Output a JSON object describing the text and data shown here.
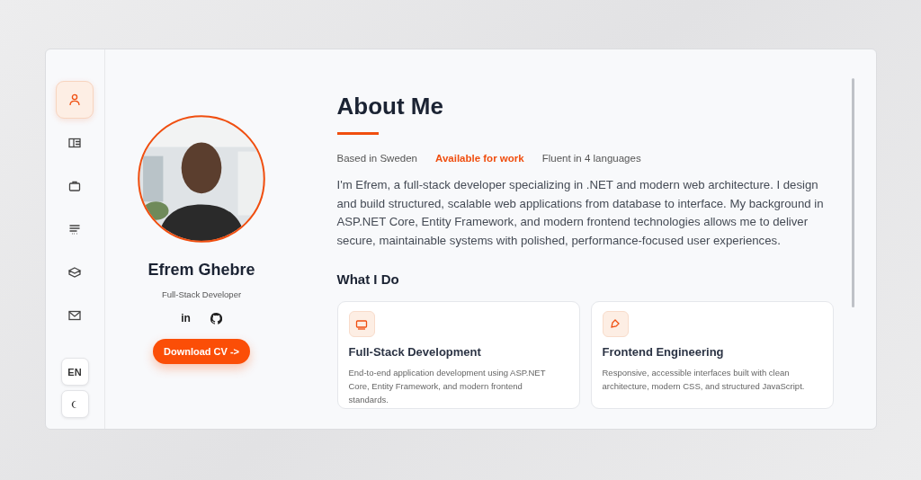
{
  "nav": [
    {
      "selected": true
    },
    {
      "selected": false
    },
    {
      "selected": false
    },
    {
      "selected": false
    },
    {
      "selected": false
    },
    {
      "selected": false
    }
  ],
  "language_button": "EN",
  "profile": {
    "name": "Efrem Ghebre",
    "role": "Full-Stack Developer",
    "social": [
      {
        "kind": "linkedin",
        "label": "in"
      },
      {
        "kind": "github"
      }
    ],
    "download_button": "Download CV ->"
  },
  "about": {
    "title": "About Me",
    "facts": [
      {
        "text": "Based in Sweden",
        "highlight": false
      },
      {
        "text": "Available for work",
        "highlight": true
      },
      {
        "text": "Fluent in 4 languages",
        "highlight": false
      }
    ],
    "bio": "I'm Efrem, a full-stack developer specializing in .NET and modern web architecture. I design and build structured, scalable web applications from database to interface. My background in ASP.NET Core, Entity Framework, and modern frontend technologies allows me to deliver secure, maintainable systems with polished, performance-focused user experiences.",
    "services_title": "What I Do",
    "services": [
      {
        "title": "Full-Stack Development",
        "description": "End-to-end application development using ASP.NET Core, Entity Framework, and modern frontend standards."
      },
      {
        "title": "Frontend Engineering",
        "description": "Responsive, accessible interfaces built with clean architecture, modern CSS, and structured JavaScript."
      }
    ]
  }
}
